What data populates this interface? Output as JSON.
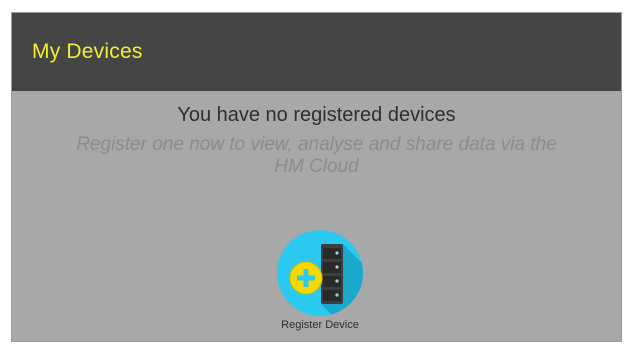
{
  "colors": {
    "header_bg": "#454545",
    "title": "#f3ef2c",
    "panel_bg": "#a8a8a8",
    "icon_circle": "#29c9f0",
    "icon_plus": "#f5d800",
    "icon_server": "#3e3e3e"
  },
  "header": {
    "title": "My Devices"
  },
  "empty_state": {
    "headline": "You have no registered devices",
    "subline": "Register one now to view, analyse and share data via the HM Cloud"
  },
  "register": {
    "icon": "register-device-icon",
    "label": "Register Device"
  }
}
